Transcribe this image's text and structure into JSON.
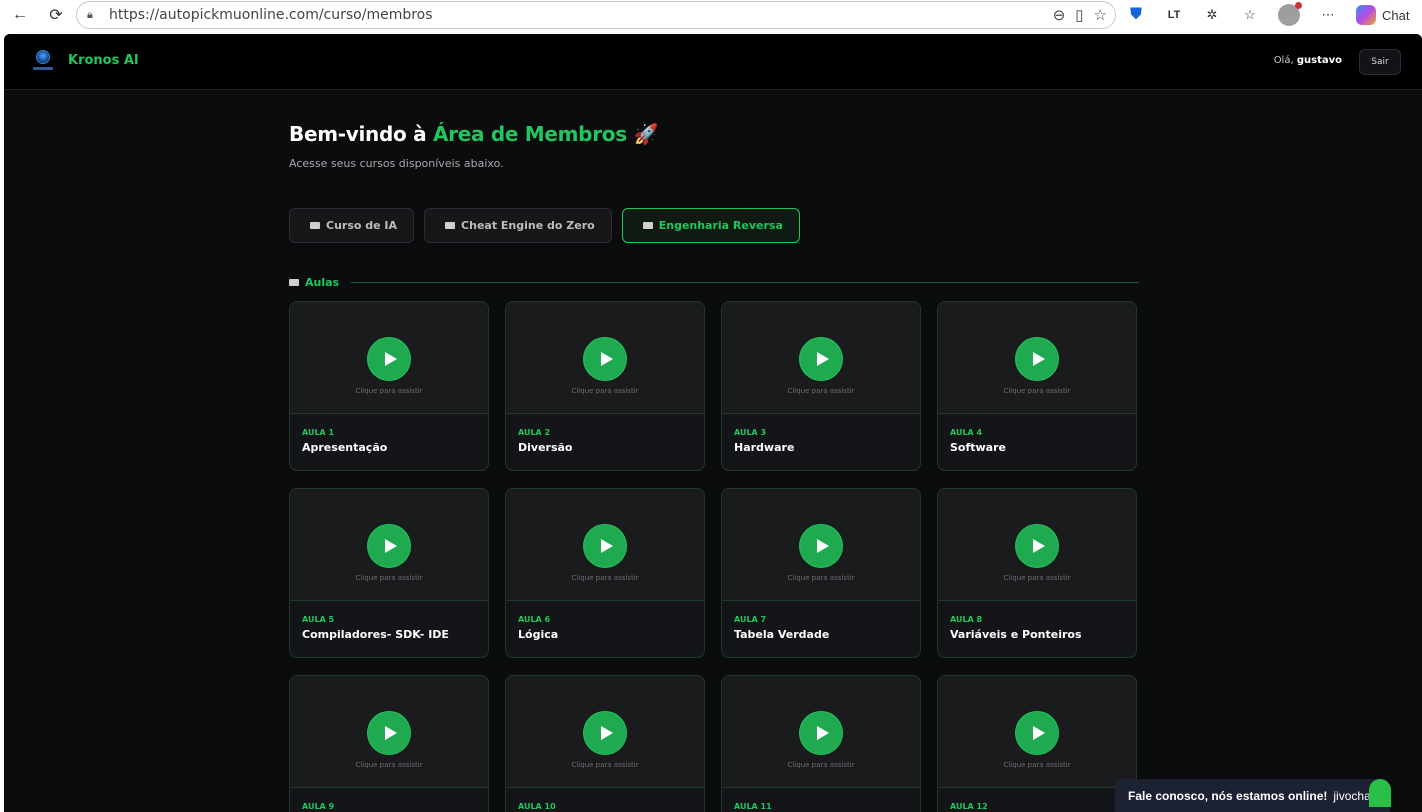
{
  "browser": {
    "url": "https://autopickmuonline.com/curso/membros",
    "chat_label": "Chat"
  },
  "header": {
    "brand": "Kronos AI",
    "greeting_prefix": "Olá,",
    "username": "gustavo",
    "logout_label": "Sair"
  },
  "main": {
    "welcome_prefix": "Bem-vindo à ",
    "welcome_accent": "Área de Membros",
    "welcome_emoji": " 🚀",
    "subtitle": "Acesse seus cursos disponíveis abaixo.",
    "tabs": [
      {
        "label": "Curso de IA",
        "active": false
      },
      {
        "label": "Cheat Engine do Zero",
        "active": false
      },
      {
        "label": "Engenharia Reversa",
        "active": true
      }
    ],
    "section_label": "Aulas",
    "watch_label": "Clique para assistir",
    "lessons": [
      {
        "num": "AULA 1",
        "title": "Apresentação"
      },
      {
        "num": "AULA 2",
        "title": "Diversão"
      },
      {
        "num": "AULA 3",
        "title": "Hardware"
      },
      {
        "num": "AULA 4",
        "title": "Software"
      },
      {
        "num": "AULA 5",
        "title": "Compiladores- SDK- IDE"
      },
      {
        "num": "AULA 6",
        "title": "Lógica"
      },
      {
        "num": "AULA 7",
        "title": "Tabela Verdade"
      },
      {
        "num": "AULA 8",
        "title": "Variáveis e Ponteiros"
      },
      {
        "num": "AULA 9",
        "title": ""
      },
      {
        "num": "AULA 10",
        "title": ""
      },
      {
        "num": "AULA 11",
        "title": ""
      },
      {
        "num": "AULA 12",
        "title": ""
      }
    ]
  },
  "livechat": {
    "message": "Fale conosco, nós estamos online!",
    "brand": "jivochat"
  },
  "colors": {
    "accent": "#22c55e",
    "background": "#0b0c0e",
    "card": "#141518"
  }
}
